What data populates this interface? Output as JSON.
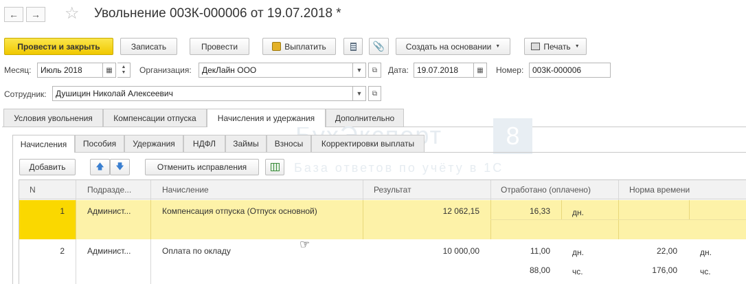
{
  "window": {
    "title": "Увольнение 003К-000006 от 19.07.2018 *"
  },
  "nav": {
    "back_icon": "←",
    "forward_icon": "→",
    "favorite_icon": "☆"
  },
  "toolbar": {
    "post_close": "Провести и закрыть",
    "save": "Записать",
    "post": "Провести",
    "pay": "Выплатить",
    "create_based_on": "Создать на основании",
    "print": "Печать"
  },
  "header": {
    "month_label": "Месяц:",
    "month_value": "Июль 2018",
    "org_label": "Организация:",
    "org_value": "ДекЛайн ООО",
    "date_label": "Дата:",
    "date_value": "19.07.2018",
    "number_label": "Номер:",
    "number_value": "003К-000006",
    "employee_label": "Сотрудник:",
    "employee_value": "Душицин Николай Алексеевич"
  },
  "tabs": [
    "Условия увольнения",
    "Компенсации отпуска",
    "Начисления и удержания",
    "Дополнительно"
  ],
  "subtabs": [
    "Начисления",
    "Пособия",
    "Удержания",
    "НДФЛ",
    "Займы",
    "Взносы",
    "Корректировки выплаты"
  ],
  "table_toolbar": {
    "add": "Добавить",
    "undo_corrections": "Отменить исправления"
  },
  "watermark": {
    "brand": "БухЭксперт",
    "version": "8",
    "tagline": "База ответов по учёту в 1С"
  },
  "table": {
    "columns": [
      "N",
      "Подразде...",
      "Начисление",
      "Результат",
      "Отработано (оплачено)",
      "Норма времени"
    ],
    "rows": [
      {
        "n": "1",
        "dept": "Админист...",
        "accrual": "Компенсация отпуска (Отпуск основной)",
        "result": "12 062,15",
        "worked": "16,33",
        "worked_unit": "дн.",
        "norm": "",
        "norm_unit": "",
        "selected": true
      },
      {
        "n": "2",
        "dept": "Админист...",
        "accrual": "Оплата по окладу",
        "result": "10 000,00",
        "worked": "11,00",
        "worked_unit": "дн.",
        "norm": "22,00",
        "norm_unit": "дн.",
        "worked2": "88,00",
        "worked2_unit": "чс.",
        "norm2": "176,00",
        "norm2_unit": "чс."
      }
    ]
  },
  "colors": {
    "primary_button": "#f3cf1a",
    "selected_row": "#fdf2a8",
    "selected_cell": "#fad800"
  }
}
